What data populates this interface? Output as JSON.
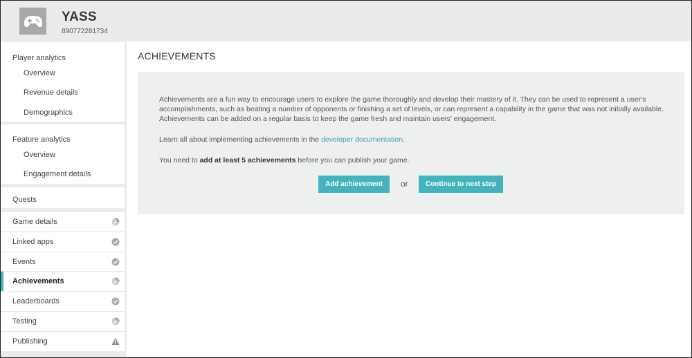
{
  "header": {
    "title": "YASS",
    "id": "890772281734",
    "icon": "gamepad-icon"
  },
  "sidebar": {
    "player_analytics": {
      "title": "Player analytics",
      "items": [
        "Overview",
        "Revenue details",
        "Demographics"
      ]
    },
    "feature_analytics": {
      "title": "Feature analytics",
      "items": [
        "Overview",
        "Engagement details"
      ]
    },
    "quests": "Quests",
    "nav": [
      {
        "label": "Game details",
        "status": "partial-icon"
      },
      {
        "label": "Linked apps",
        "status": "check-icon"
      },
      {
        "label": "Events",
        "status": "check-icon"
      },
      {
        "label": "Achievements",
        "status": "partial-icon",
        "active": true
      },
      {
        "label": "Leaderboards",
        "status": "check-icon"
      },
      {
        "label": "Testing",
        "status": "partial-icon"
      },
      {
        "label": "Publishing",
        "status": "warning-icon"
      }
    ]
  },
  "main": {
    "title": "ACHIEVEMENTS",
    "intro": "Achievements are a fun way to encourage users to explore the game thoroughly and develop their mastery of it. They can be used to represent a user's accomplishments, such as beating a number of opponents or finishing a set of levels, or can represent a capability in the game that was not initially available. Achievements can be added on a regular basis to keep the game fresh and maintain users' engagement.",
    "learn_prefix": "Learn all about implementing achievements in the ",
    "learn_link": "developer documentation",
    "learn_suffix": ".",
    "need_prefix": "You need to ",
    "need_bold": "add at least 5 achievements",
    "need_suffix": " before you can publish your game.",
    "add_button": "Add achievement",
    "or": "or",
    "continue_button": "Continue to next step"
  },
  "colors": {
    "accent": "#43b4be",
    "link": "#3f9ea8",
    "header_bg": "#ebebeb",
    "panel_bg": "#eeefef"
  }
}
